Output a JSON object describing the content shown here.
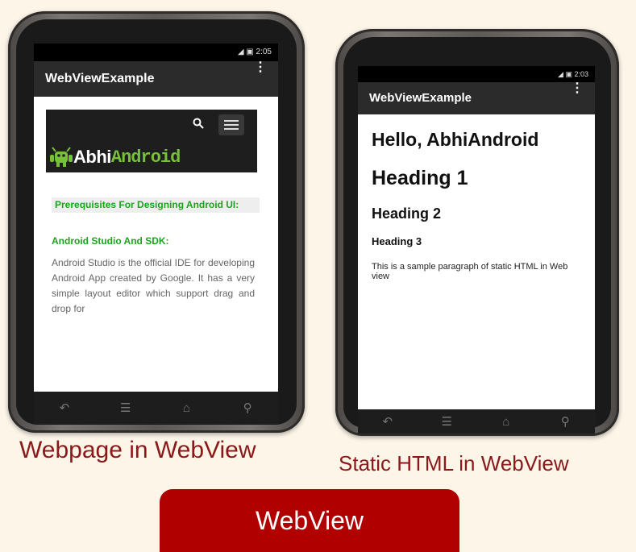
{
  "left_phone": {
    "status_time": "2:05",
    "app_title": "WebViewExample",
    "menu_glyph": "⋮",
    "web": {
      "search_icon": "search-icon",
      "menu_icon": "hamburger-icon",
      "logo_text_1": "Abhi",
      "logo_text_2": "Android",
      "prereq_heading": "Prerequisites For Designing Android UI:",
      "subheading": "Android Studio And SDK:",
      "paragraph": "Android Studio is the official IDE for developing Android App created by Google. It has a very simple layout editor which support drag and drop for"
    },
    "caption": "Webpage in WebView"
  },
  "right_phone": {
    "status_time": "2:03",
    "app_title": "WebViewExample",
    "menu_glyph": "⋮",
    "html": {
      "greeting": "Hello, AbhiAndroid",
      "heading1": "Heading 1",
      "heading2": "Heading 2",
      "heading3": "Heading 3",
      "paragraph": "This is a sample paragraph of static HTML in Web view"
    },
    "caption": "Static HTML in WebView"
  },
  "nav_glyphs": {
    "back": "↶",
    "menu": "☰",
    "home": "⌂",
    "search": "⚲"
  },
  "banner_button": "WebView",
  "colors": {
    "caption": "#8a1a1a",
    "banner": "#b00000",
    "android_green": "#1ca51c"
  }
}
